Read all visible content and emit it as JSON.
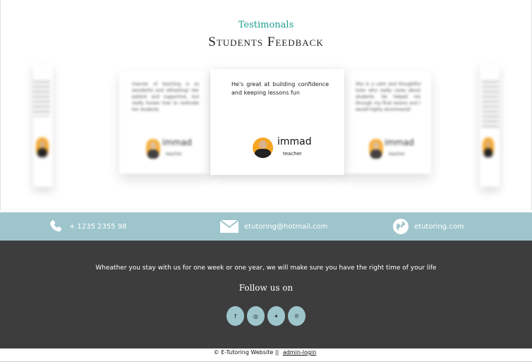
{
  "testimonials": {
    "label": "Testimonals",
    "title": "Students Feedback",
    "cards": [
      {
        "quote": "manner of teaching is so wonderful and refreshing! Her patient and supportive, but really knows how to motivate her students.",
        "name": "immad",
        "role": "teacher"
      },
      {
        "quote": "He's great at building confidence and keeping lessons fun",
        "name": "immad",
        "role": "teacher"
      },
      {
        "quote": "She is a calm and thoughtful tutor who really cares about students. He helped me through my final exams and I would highly recommend!",
        "name": "immad",
        "role": "teacher"
      }
    ]
  },
  "contact": {
    "phone": "+ 1235 2355 98",
    "email": "etutoring@hotmail.com",
    "website": "etutoring.com"
  },
  "footer": {
    "tagline": "Wheather you stay with us for one week or one year, we will make sure you have the right time of your life",
    "follow": "Follow us on",
    "socials": [
      {
        "glyph": "f",
        "icon": "facebook-icon"
      },
      {
        "glyph": "◎",
        "icon": "instagram-icon"
      },
      {
        "glyph": "✦",
        "icon": "twitter-icon"
      },
      {
        "glyph": "℗",
        "icon": "pinterest-icon"
      }
    ]
  },
  "copyright": {
    "text": "© E-Tutoring Website ||",
    "admin_link": "admin-login"
  },
  "colors": {
    "accent": "#1a9e8f",
    "contact_bar": "#9ec5cc",
    "footer_bg": "#3d3d3d",
    "avatar_bg": "#f5a623"
  }
}
